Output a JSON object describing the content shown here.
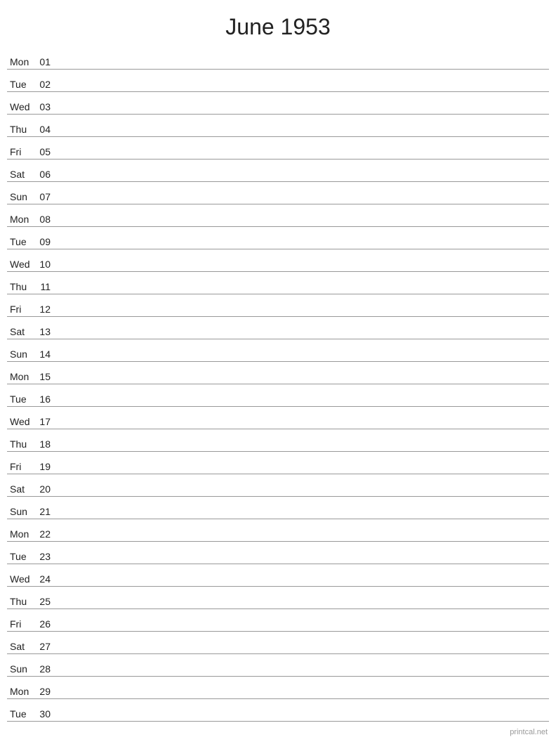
{
  "header": {
    "title": "June 1953"
  },
  "days": [
    {
      "name": "Mon",
      "number": "01"
    },
    {
      "name": "Tue",
      "number": "02"
    },
    {
      "name": "Wed",
      "number": "03"
    },
    {
      "name": "Thu",
      "number": "04"
    },
    {
      "name": "Fri",
      "number": "05"
    },
    {
      "name": "Sat",
      "number": "06"
    },
    {
      "name": "Sun",
      "number": "07"
    },
    {
      "name": "Mon",
      "number": "08"
    },
    {
      "name": "Tue",
      "number": "09"
    },
    {
      "name": "Wed",
      "number": "10"
    },
    {
      "name": "Thu",
      "number": "11"
    },
    {
      "name": "Fri",
      "number": "12"
    },
    {
      "name": "Sat",
      "number": "13"
    },
    {
      "name": "Sun",
      "number": "14"
    },
    {
      "name": "Mon",
      "number": "15"
    },
    {
      "name": "Tue",
      "number": "16"
    },
    {
      "name": "Wed",
      "number": "17"
    },
    {
      "name": "Thu",
      "number": "18"
    },
    {
      "name": "Fri",
      "number": "19"
    },
    {
      "name": "Sat",
      "number": "20"
    },
    {
      "name": "Sun",
      "number": "21"
    },
    {
      "name": "Mon",
      "number": "22"
    },
    {
      "name": "Tue",
      "number": "23"
    },
    {
      "name": "Wed",
      "number": "24"
    },
    {
      "name": "Thu",
      "number": "25"
    },
    {
      "name": "Fri",
      "number": "26"
    },
    {
      "name": "Sat",
      "number": "27"
    },
    {
      "name": "Sun",
      "number": "28"
    },
    {
      "name": "Mon",
      "number": "29"
    },
    {
      "name": "Tue",
      "number": "30"
    }
  ],
  "watermark": "printcal.net"
}
